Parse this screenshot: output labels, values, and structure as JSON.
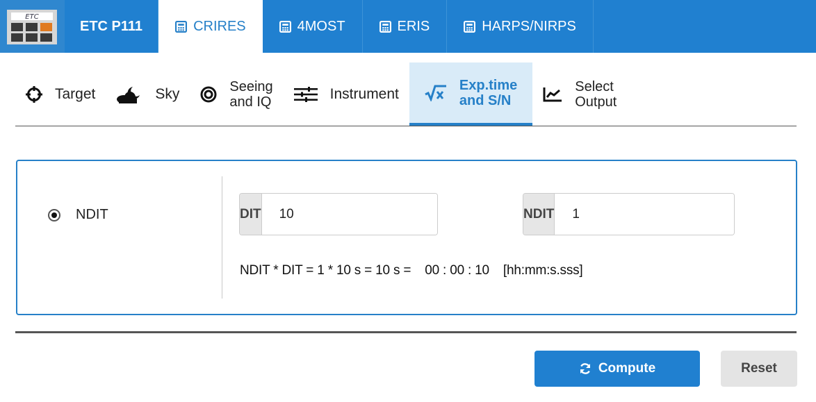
{
  "topnav": {
    "brand": "ETC P111",
    "tabs": [
      {
        "label": "CRIRES",
        "active": true
      },
      {
        "label": "4MOST",
        "active": false
      },
      {
        "label": "ERIS",
        "active": false
      },
      {
        "label": "HARPS/NIRPS",
        "active": false
      }
    ],
    "logo_text": "ETC"
  },
  "subtabs": [
    {
      "icon": "crosshair-icon",
      "line1": "Target",
      "line2": ""
    },
    {
      "icon": "moon-cloud-icon",
      "line1": "Sky",
      "line2": ""
    },
    {
      "icon": "target-rings-icon",
      "line1": "Seeing",
      "line2": "and IQ"
    },
    {
      "icon": "sliders-icon",
      "line1": "Instrument",
      "line2": ""
    },
    {
      "icon": "square-root-icon",
      "line1": "Exp.time",
      "line2": "and S/N",
      "active": true
    },
    {
      "icon": "line-chart-icon",
      "line1": "Select",
      "line2": "Output"
    }
  ],
  "exposure": {
    "radio_label": "NDIT",
    "dit_label": "DIT",
    "dit_value": "10",
    "ndit_label": "NDIT",
    "ndit_value": "1",
    "formula_left": "NDIT * DIT = 1 * 10 s = 10 s =",
    "formula_time": "00 : 00 : 10",
    "formula_unit": "[hh:mm:s.sss]"
  },
  "buttons": {
    "compute": "Compute",
    "reset": "Reset"
  },
  "colors": {
    "primary": "#2080d0",
    "active_tab_bg": "#d9ebf8",
    "addon_bg": "#e6e6e6",
    "reset_bg": "#e4e4e4"
  }
}
